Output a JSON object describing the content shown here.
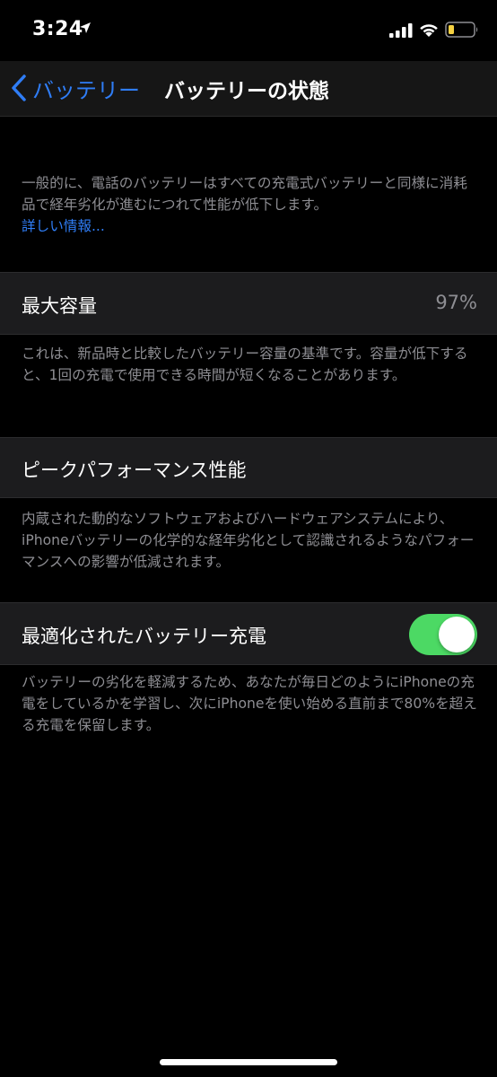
{
  "status_bar": {
    "time": "3:24",
    "icons": [
      "location-arrow-icon",
      "cellular-signal-icon",
      "wifi-icon",
      "battery-icon"
    ],
    "battery_color": "#f5d142"
  },
  "nav": {
    "back_label": "バッテリー",
    "title": "バッテリーの状態",
    "accent": "#2f7df6"
  },
  "intro": {
    "text": "一般的に、電話のバッテリーはすべての充電式バッテリーと同様に消耗品で経年劣化が進むにつれて性能が低下します。",
    "link": "詳しい情報..."
  },
  "max_capacity": {
    "label": "最大容量",
    "value": "97%",
    "description": "これは、新品時と比較したバッテリー容量の基準です。容量が低下すると、1回の充電で使用できる時間が短くなることがあります。"
  },
  "peak_performance": {
    "label": "ピークパフォーマンス性能",
    "description": "内蔵された動的なソフトウェアおよびハードウェアシステムにより、iPhoneバッテリーの化学的な経年劣化として認識されるようなパフォーマンスへの影響が低減されます。"
  },
  "optimized_charging": {
    "label": "最適化されたバッテリー充電",
    "enabled": true,
    "toggle_color": "#4cd964",
    "description": "バッテリーの劣化を軽減するため、あなたが毎日どのようにiPhoneの充電をしているかを学習し、次にiPhoneを使い始める直前まで80%を超える充電を保留します。"
  }
}
